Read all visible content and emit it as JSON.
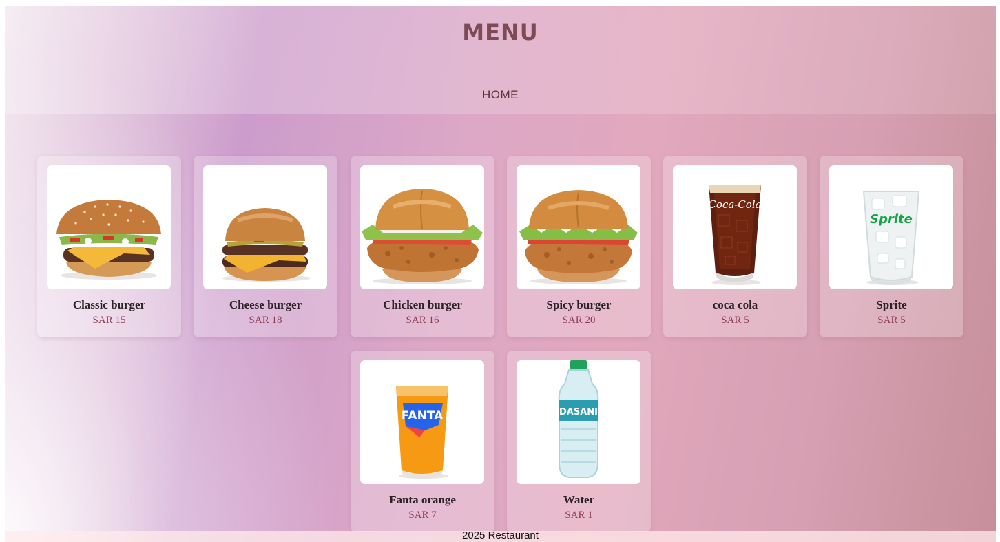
{
  "header": {
    "title": "MENU",
    "nav": {
      "home_label": "HOME"
    }
  },
  "menu": {
    "items": [
      {
        "name": "Classic burger",
        "price": "SAR 15",
        "icon": "classic-burger-image"
      },
      {
        "name": "Cheese burger",
        "price": "SAR 18",
        "icon": "cheese-burger-image"
      },
      {
        "name": "Chicken burger",
        "price": "SAR 16",
        "icon": "chicken-burger-image"
      },
      {
        "name": "Spicy burger",
        "price": "SAR 20",
        "icon": "spicy-burger-image"
      },
      {
        "name": "coca cola",
        "price": "SAR 5",
        "icon": "coca-cola-image",
        "logo_text": "Coca-Cola"
      },
      {
        "name": "Sprite",
        "price": "SAR 5",
        "icon": "sprite-image",
        "logo_text": "Sprite"
      },
      {
        "name": "Fanta orange",
        "price": "SAR 7",
        "icon": "fanta-image",
        "logo_text": "FANTA"
      },
      {
        "name": "Water",
        "price": "SAR 1",
        "icon": "water-bottle-image",
        "logo_text": "DASANI"
      }
    ]
  },
  "footer": {
    "text": "2025 Restaurant"
  },
  "colors": {
    "title": "#7d4a55",
    "price": "#8e3b55",
    "nav_link": "#5c2f36"
  }
}
